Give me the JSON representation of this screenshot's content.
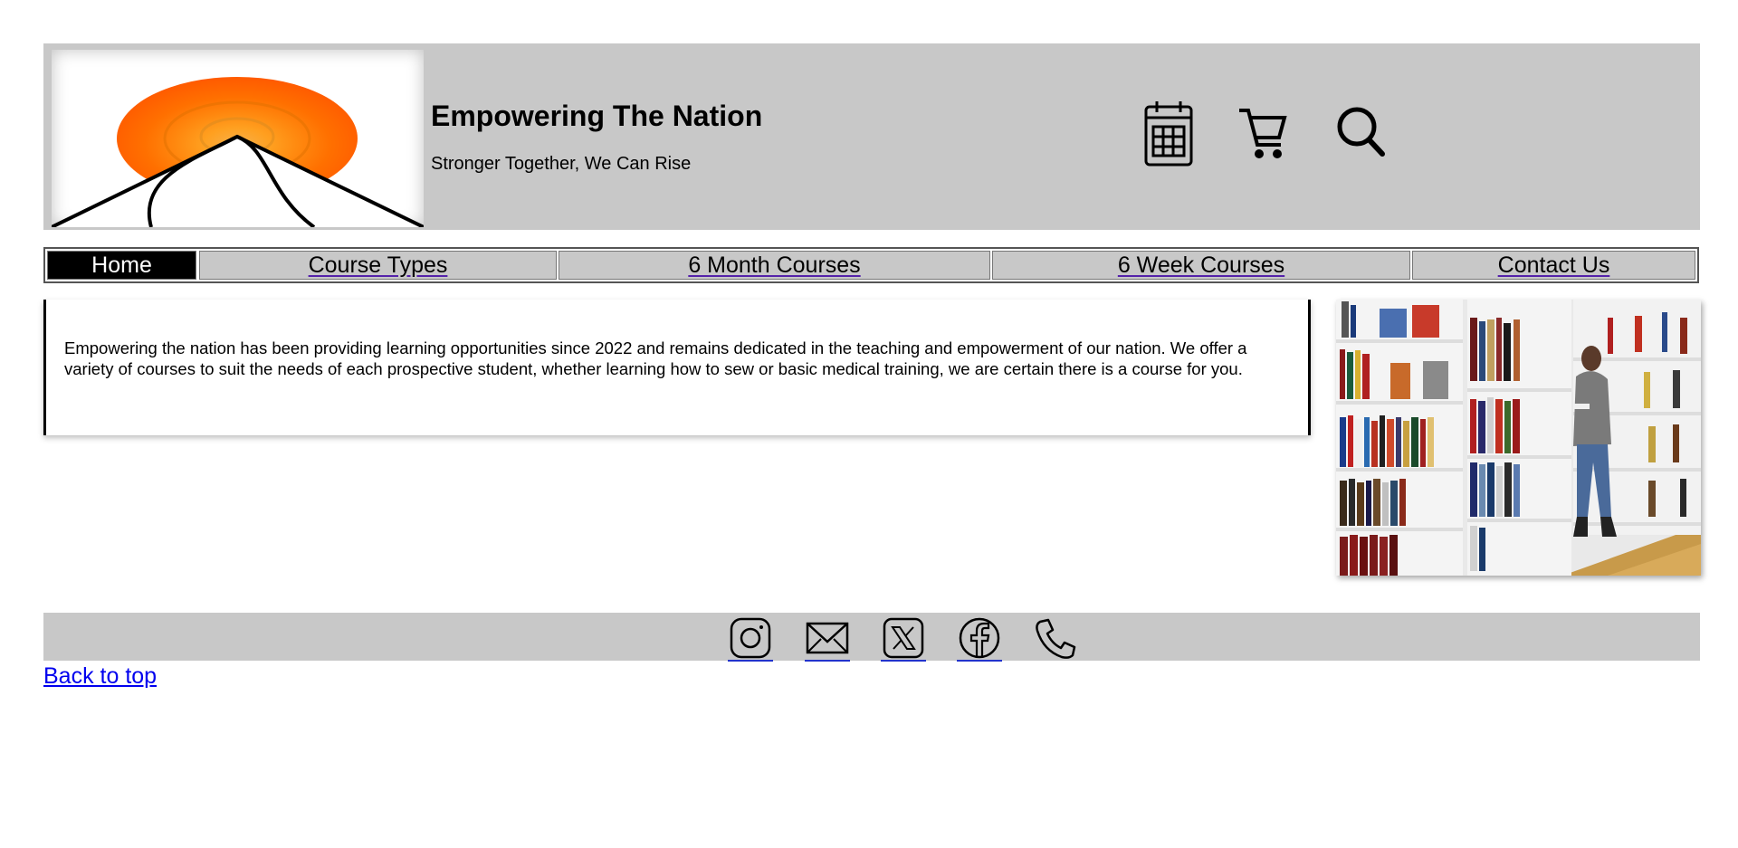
{
  "header": {
    "title": "Empowering The Nation",
    "tagline": "Stronger Together, We Can Rise",
    "logo_icon": "sunrise-mountain-logo",
    "icons": [
      "calendar-icon",
      "cart-icon",
      "search-icon"
    ]
  },
  "nav": {
    "items": [
      {
        "label": "Home",
        "active": true
      },
      {
        "label": "Course Types",
        "active": false
      },
      {
        "label": "6 Month Courses",
        "active": false
      },
      {
        "label": "6 Week Courses",
        "active": false
      },
      {
        "label": "Contact Us",
        "active": false
      }
    ]
  },
  "main": {
    "intro": "Empowering the nation has been providing learning opportunities since 2022 and remains dedicated in the teaching and empowerment of our nation. We offer a variety of courses to suit the needs of each prospective student, whether learning how to sew or basic medical training, we are certain there is a course for you.",
    "image": "library-bookshelf-photo"
  },
  "footer": {
    "icons": [
      "instagram-icon",
      "mail-icon",
      "x-twitter-icon",
      "facebook-icon",
      "phone-icon"
    ],
    "back_to_top": "Back to top"
  },
  "colors": {
    "header_bg": "#c8c8c8",
    "nav_active_bg": "#000000",
    "link": "#0000ee",
    "logo_sun": "#ff6600"
  }
}
